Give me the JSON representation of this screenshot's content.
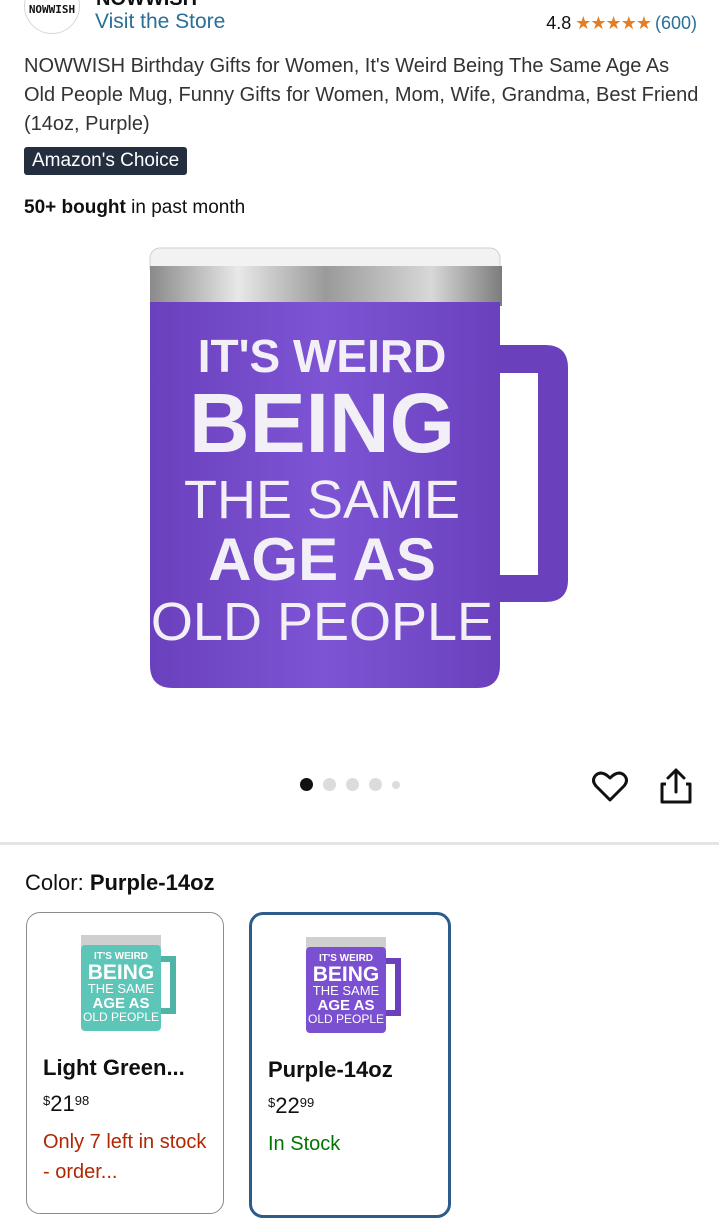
{
  "header": {
    "brand_logo_text": "NOWWISH",
    "brand_name": "NOWWISH",
    "visit_store": "Visit the Store",
    "rating_value": "4.8",
    "rating_stars": "★★★★★",
    "rating_count": "(600)"
  },
  "product": {
    "title": "NOWWISH Birthday Gifts for Women, It's Weird Being The Same Age As Old People Mug, Funny Gifts for Women, Mom, Wife, Grandma, Best Friend (14oz, Purple)",
    "badge": "Amazon's Choice",
    "bought_bold": "50+ bought",
    "bought_rest": " in past month",
    "mug_text": [
      "IT'S WEIRD",
      "BEING",
      "THE SAME",
      "AGE AS",
      "OLD PEOPLE"
    ]
  },
  "gallery": {
    "dot_count": 5,
    "active_index": 0
  },
  "color": {
    "label": "Color:",
    "selected": "Purple-14oz",
    "options": [
      {
        "name": "Light Green...",
        "price_symbol": "$",
        "price_whole": "21",
        "price_cents": "98",
        "stock": "Only 7 left in stock - order...",
        "mug_color": "#5dc6b8"
      },
      {
        "name": "Purple-14oz",
        "price_symbol": "$",
        "price_whole": "22",
        "price_cents": "99",
        "stock": "In Stock",
        "mug_color": "#7a4fd0"
      }
    ]
  },
  "colors": {
    "mug_purple": "#7a4fd0",
    "link": "#2a6f97",
    "star": "#e57d22",
    "badge_bg": "#232f3e",
    "selected_border": "#2b5c8a"
  }
}
